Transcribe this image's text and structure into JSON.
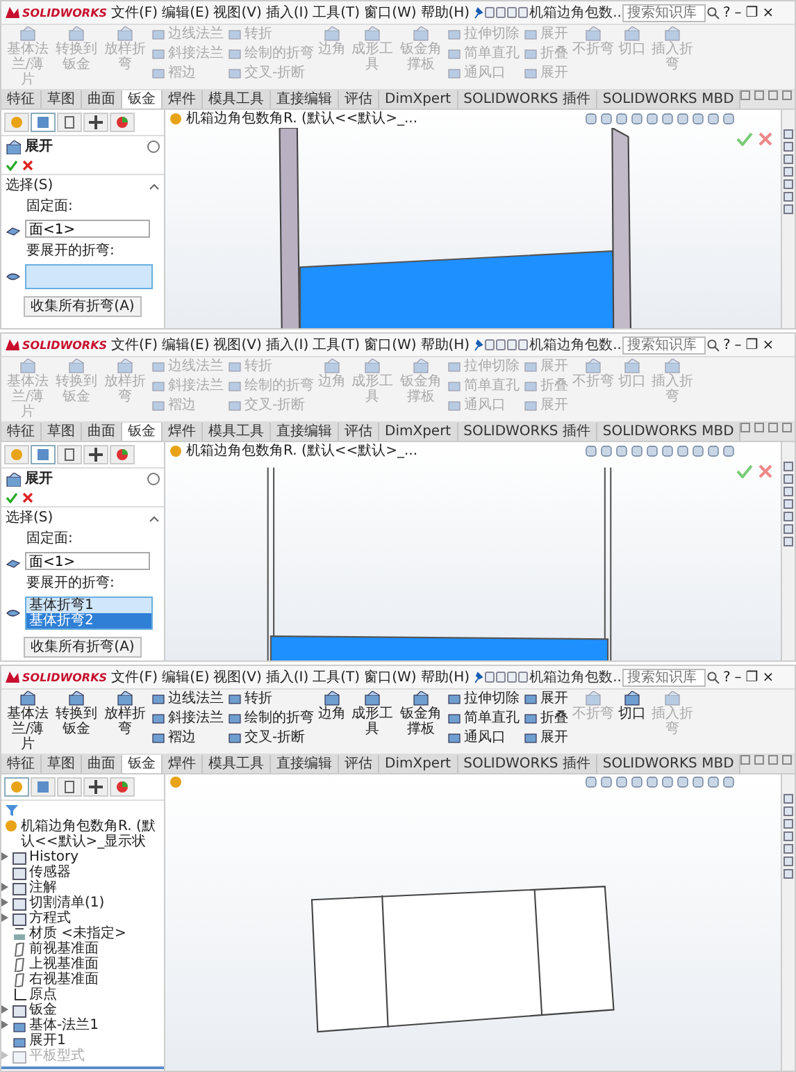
{
  "panels": [
    {
      "title_bar": {
        "logo": "SOLIDWORKS",
        "menus": [
          "文件(F)",
          "编辑(E)",
          "视图(V)",
          "插入(I)",
          "工具(T)",
          "窗口(W)",
          "帮助(H)"
        ],
        "document": "机箱边角包数..",
        "search": {
          "placeholder": "搜索知识库"
        },
        "controls": [
          "?",
          "–",
          "❐",
          "×"
        ]
      },
      "ribbon": [
        {
          "kind": "big",
          "label": "基体法兰/薄片",
          "disabled": true
        },
        {
          "kind": "big",
          "label": "转换到钣金",
          "disabled": true
        },
        {
          "kind": "big",
          "label": "放样折弯",
          "disabled": true
        },
        {
          "kind": "stack",
          "items": [
            {
              "label": "边线法兰",
              "disabled": true
            },
            {
              "label": "斜接法兰",
              "disabled": true
            },
            {
              "label": "褶边",
              "disabled": true
            }
          ]
        },
        {
          "kind": "stack",
          "items": [
            {
              "label": "转折",
              "disabled": true
            },
            {
              "label": "绘制的折弯",
              "disabled": true
            },
            {
              "label": "交叉-折断",
              "disabled": true
            }
          ]
        },
        {
          "kind": "big",
          "label": "边角",
          "disabled": true
        },
        {
          "kind": "big",
          "label": "成形工具",
          "disabled": true
        },
        {
          "kind": "big",
          "label": "钣金角撑板",
          "disabled": true
        },
        {
          "kind": "stack",
          "items": [
            {
              "label": "拉伸切除",
              "disabled": true
            },
            {
              "label": "简单直孔",
              "disabled": true
            },
            {
              "label": "通风口",
              "disabled": true
            }
          ]
        },
        {
          "kind": "stack",
          "items": [
            {
              "label": "展开",
              "disabled": true
            },
            {
              "label": "折叠",
              "disabled": true
            },
            {
              "label": "展开",
              "disabled": true
            }
          ]
        },
        {
          "kind": "big",
          "label": "不折弯",
          "disabled": true
        },
        {
          "kind": "big",
          "label": "切口",
          "disabled": true
        },
        {
          "kind": "big",
          "label": "插入折弯",
          "disabled": true
        }
      ],
      "tabs": [
        {
          "label": "特征",
          "selected": false
        },
        {
          "label": "草图",
          "selected": false
        },
        {
          "label": "曲面",
          "selected": false
        },
        {
          "label": "钣金",
          "selected": true
        },
        {
          "label": "焊件",
          "selected": false
        },
        {
          "label": "模具工具",
          "selected": false
        },
        {
          "label": "直接编辑",
          "selected": false
        },
        {
          "label": "评估",
          "selected": false
        },
        {
          "label": "DimXpert",
          "selected": false
        },
        {
          "label": "SOLIDWORKS 插件",
          "selected": false
        },
        {
          "label": "SOLIDWORKS MBD",
          "selected": false
        }
      ],
      "side_tabs": [
        {
          "selected": false
        },
        {
          "selected": true
        },
        {
          "selected": false
        },
        {
          "selected": false
        },
        {
          "selected": false
        }
      ],
      "property_manager": {
        "title": "展开",
        "section": "选择(S)",
        "fixed_face_label": "固定面:",
        "fixed_face": "面<1>",
        "bends_label": "要展开的折弯:",
        "button": "收集所有折弯(A)"
      },
      "view_path": "机箱边角包数角R. (默认<<默认>_...",
      "confirm_corner": true,
      "model": {
        "kind": "iso"
      }
    },
    {
      "title_bar": {
        "logo": "SOLIDWORKS",
        "menus": [
          "文件(F)",
          "编辑(E)",
          "视图(V)",
          "插入(I)",
          "工具(T)",
          "窗口(W)",
          "帮助(H)"
        ],
        "document": "机箱边角包数..",
        "search": {
          "placeholder": "搜索知识库"
        },
        "controls": [
          "?",
          "–",
          "❐",
          "×"
        ]
      },
      "ribbon": [
        {
          "kind": "big",
          "label": "基体法兰/薄片",
          "disabled": true
        },
        {
          "kind": "big",
          "label": "转换到钣金",
          "disabled": true
        },
        {
          "kind": "big",
          "label": "放样折弯",
          "disabled": true
        },
        {
          "kind": "stack",
          "items": [
            {
              "label": "边线法兰",
              "disabled": true
            },
            {
              "label": "斜接法兰",
              "disabled": true
            },
            {
              "label": "褶边",
              "disabled": true
            }
          ]
        },
        {
          "kind": "stack",
          "items": [
            {
              "label": "转折",
              "disabled": true
            },
            {
              "label": "绘制的折弯",
              "disabled": true
            },
            {
              "label": "交叉-折断",
              "disabled": true
            }
          ]
        },
        {
          "kind": "big",
          "label": "边角",
          "disabled": true
        },
        {
          "kind": "big",
          "label": "成形工具",
          "disabled": true
        },
        {
          "kind": "big",
          "label": "钣金角撑板",
          "disabled": true
        },
        {
          "kind": "stack",
          "items": [
            {
              "label": "拉伸切除",
              "disabled": true
            },
            {
              "label": "简单直孔",
              "disabled": true
            },
            {
              "label": "通风口",
              "disabled": true
            }
          ]
        },
        {
          "kind": "stack",
          "items": [
            {
              "label": "展开",
              "disabled": true
            },
            {
              "label": "折叠",
              "disabled": true
            },
            {
              "label": "展开",
              "disabled": true
            }
          ]
        },
        {
          "kind": "big",
          "label": "不折弯",
          "disabled": true
        },
        {
          "kind": "big",
          "label": "切口",
          "disabled": true
        },
        {
          "kind": "big",
          "label": "插入折弯",
          "disabled": true
        }
      ],
      "tabs": [
        {
          "label": "特征",
          "selected": false
        },
        {
          "label": "草图",
          "selected": false
        },
        {
          "label": "曲面",
          "selected": false
        },
        {
          "label": "钣金",
          "selected": true
        },
        {
          "label": "焊件",
          "selected": false
        },
        {
          "label": "模具工具",
          "selected": false
        },
        {
          "label": "直接编辑",
          "selected": false
        },
        {
          "label": "评估",
          "selected": false
        },
        {
          "label": "DimXpert",
          "selected": false
        },
        {
          "label": "SOLIDWORKS 插件",
          "selected": false
        },
        {
          "label": "SOLIDWORKS MBD",
          "selected": false
        }
      ],
      "side_tabs": [
        {
          "selected": false
        },
        {
          "selected": true
        },
        {
          "selected": false
        },
        {
          "selected": false
        },
        {
          "selected": false
        }
      ],
      "property_manager": {
        "title": "展开",
        "section": "选择(S)",
        "fixed_face_label": "固定面:",
        "fixed_face": "面<1>",
        "bends_label": "要展开的折弯:",
        "bends": [
          {
            "label": "基体折弯1",
            "selected": false
          },
          {
            "label": "基体折弯2",
            "selected": true
          }
        ],
        "button": "收集所有折弯(A)"
      },
      "view_path": "机箱边角包数角R. (默认<<默认>_...",
      "confirm_corner": true,
      "model": {
        "kind": "front"
      }
    },
    {
      "title_bar": {
        "logo": "SOLIDWORKS",
        "menus": [
          "文件(F)",
          "编辑(E)",
          "视图(V)",
          "插入(I)",
          "工具(T)",
          "窗口(W)",
          "帮助(H)"
        ],
        "document": "机箱边角包数..",
        "search": {
          "placeholder": "搜索知识库"
        },
        "controls": [
          "?",
          "–",
          "❐",
          "×"
        ]
      },
      "ribbon": [
        {
          "kind": "big",
          "label": "基体法兰/薄片",
          "disabled": false
        },
        {
          "kind": "big",
          "label": "转换到钣金",
          "disabled": false
        },
        {
          "kind": "big",
          "label": "放样折弯",
          "disabled": false
        },
        {
          "kind": "stack",
          "items": [
            {
              "label": "边线法兰",
              "disabled": false
            },
            {
              "label": "斜接法兰",
              "disabled": false
            },
            {
              "label": "褶边",
              "disabled": false
            }
          ]
        },
        {
          "kind": "stack",
          "items": [
            {
              "label": "转折",
              "disabled": false
            },
            {
              "label": "绘制的折弯",
              "disabled": false
            },
            {
              "label": "交叉-折断",
              "disabled": false
            }
          ]
        },
        {
          "kind": "big",
          "label": "边角",
          "disabled": false
        },
        {
          "kind": "big",
          "label": "成形工具",
          "disabled": false
        },
        {
          "kind": "big",
          "label": "钣金角撑板",
          "disabled": false
        },
        {
          "kind": "stack",
          "items": [
            {
              "label": "拉伸切除",
              "disabled": false
            },
            {
              "label": "简单直孔",
              "disabled": false
            },
            {
              "label": "通风口",
              "disabled": false
            }
          ]
        },
        {
          "kind": "stack",
          "items": [
            {
              "label": "展开",
              "disabled": false
            },
            {
              "label": "折叠",
              "disabled": false
            },
            {
              "label": "展开",
              "disabled": false
            }
          ]
        },
        {
          "kind": "big",
          "label": "不折弯",
          "disabled": true
        },
        {
          "kind": "big",
          "label": "切口",
          "disabled": false
        },
        {
          "kind": "big",
          "label": "插入折弯",
          "disabled": true
        }
      ],
      "tabs": [
        {
          "label": "特征",
          "selected": false
        },
        {
          "label": "草图",
          "selected": false
        },
        {
          "label": "曲面",
          "selected": false
        },
        {
          "label": "钣金",
          "selected": true
        },
        {
          "label": "焊件",
          "selected": false
        },
        {
          "label": "模具工具",
          "selected": false
        },
        {
          "label": "直接编辑",
          "selected": false
        },
        {
          "label": "评估",
          "selected": false
        },
        {
          "label": "DimXpert",
          "selected": false
        },
        {
          "label": "SOLIDWORKS 插件",
          "selected": false
        },
        {
          "label": "SOLIDWORKS MBD",
          "selected": false
        }
      ],
      "side_tabs": [
        {
          "selected": true
        },
        {
          "selected": false
        },
        {
          "selected": false
        },
        {
          "selected": false
        },
        {
          "selected": false
        }
      ],
      "feature_tree": {
        "root": "机箱边角包数角R. (默认<<默认>_显示状",
        "items": [
          {
            "label": "History",
            "kind": "folder",
            "expandable": true,
            "disabled": false
          },
          {
            "label": "传感器",
            "kind": "folder",
            "expandable": false,
            "disabled": false
          },
          {
            "label": "注解",
            "kind": "folder",
            "expandable": true,
            "disabled": false
          },
          {
            "label": "切割清单(1)",
            "kind": "folder",
            "expandable": true,
            "disabled": false
          },
          {
            "label": "方程式",
            "kind": "folder",
            "expandable": true,
            "disabled": false
          },
          {
            "label": "材质 <未指定>",
            "kind": "material",
            "expandable": false,
            "disabled": false
          },
          {
            "label": "前视基准面",
            "kind": "plane",
            "expandable": false,
            "disabled": false
          },
          {
            "label": "上视基准面",
            "kind": "plane",
            "expandable": false,
            "disabled": false
          },
          {
            "label": "右视基准面",
            "kind": "plane",
            "expandable": false,
            "disabled": false
          },
          {
            "label": "原点",
            "kind": "origin",
            "expandable": false,
            "disabled": false
          },
          {
            "label": "钣金",
            "kind": "folder",
            "expandable": true,
            "disabled": false
          },
          {
            "label": "基体-法兰1",
            "kind": "feature",
            "expandable": true,
            "disabled": false
          },
          {
            "label": "展开1",
            "kind": "feature",
            "expandable": false,
            "disabled": false
          },
          {
            "label": "平板型式",
            "kind": "folder",
            "expandable": true,
            "disabled": true
          }
        ]
      },
      "confirm_corner": false,
      "model": {
        "kind": "flat"
      }
    }
  ]
}
